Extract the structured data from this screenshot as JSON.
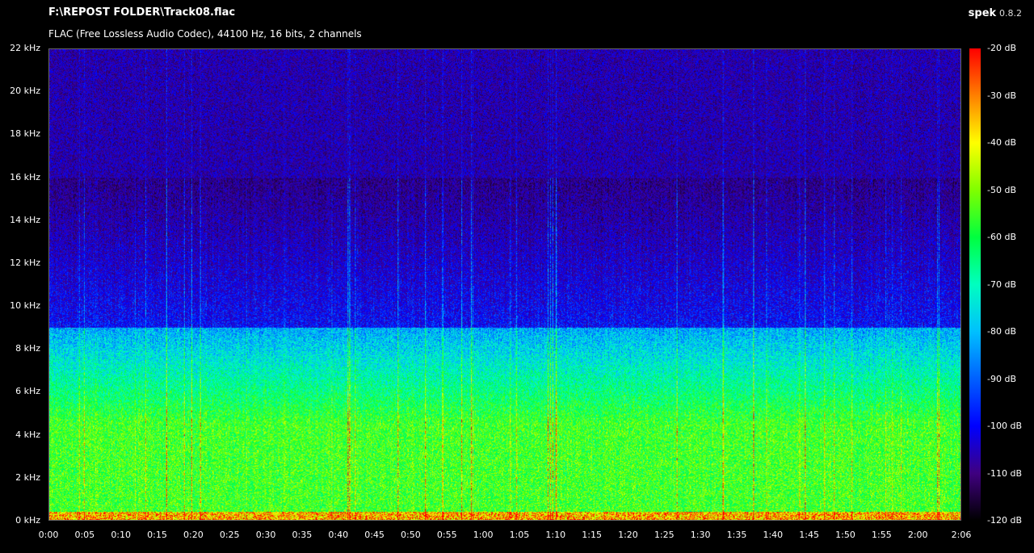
{
  "header": {
    "file_path": "F:\\REPOST FOLDER\\Track08.flac",
    "info": "FLAC (Free Lossless Audio Codec), 44100 Hz, 16 bits, 2 channels",
    "app_name": "spek",
    "app_version": "0.8.2"
  },
  "frequency_axis": {
    "labels": [
      "22 kHz",
      "20 kHz",
      "18 kHz",
      "16 kHz",
      "14 kHz",
      "12 kHz",
      "10 kHz",
      "8 kHz",
      "6 kHz",
      "4 kHz",
      "2 kHz",
      "0 kHz"
    ],
    "values_khz": [
      22,
      20,
      18,
      16,
      14,
      12,
      10,
      8,
      6,
      4,
      2,
      0
    ]
  },
  "time_axis": {
    "labels": [
      "0:00",
      "0:05",
      "0:10",
      "0:15",
      "0:20",
      "0:25",
      "0:30",
      "0:35",
      "0:40",
      "0:45",
      "0:50",
      "0:55",
      "1:00",
      "1:05",
      "1:10",
      "1:15",
      "1:20",
      "1:25",
      "1:30",
      "1:35",
      "1:40",
      "1:45",
      "1:50",
      "1:55",
      "2:00",
      "2:06"
    ],
    "seconds": [
      0,
      5,
      10,
      15,
      20,
      25,
      30,
      35,
      40,
      45,
      50,
      55,
      60,
      65,
      70,
      75,
      80,
      85,
      90,
      95,
      100,
      105,
      110,
      115,
      120,
      126
    ],
    "duration_s": 126
  },
  "db_scale": {
    "labels": [
      "-20 dB",
      "-30 dB",
      "-40 dB",
      "-50 dB",
      "-60 dB",
      "-70 dB",
      "-80 dB",
      "-90 dB",
      "-100 dB",
      "-110 dB",
      "-120 dB"
    ],
    "values": [
      -20,
      -30,
      -40,
      -50,
      -60,
      -70,
      -80,
      -90,
      -100,
      -110,
      -120
    ],
    "colors": [
      "#ff0000",
      "#ff8000",
      "#ffff00",
      "#80ff00",
      "#00ff40",
      "#00ffc0",
      "#00c0ff",
      "#0060ff",
      "#0000ff",
      "#400080",
      "#000000"
    ]
  },
  "colors": {
    "background": "#000000",
    "text": "#ffffff",
    "border": "#666666"
  }
}
